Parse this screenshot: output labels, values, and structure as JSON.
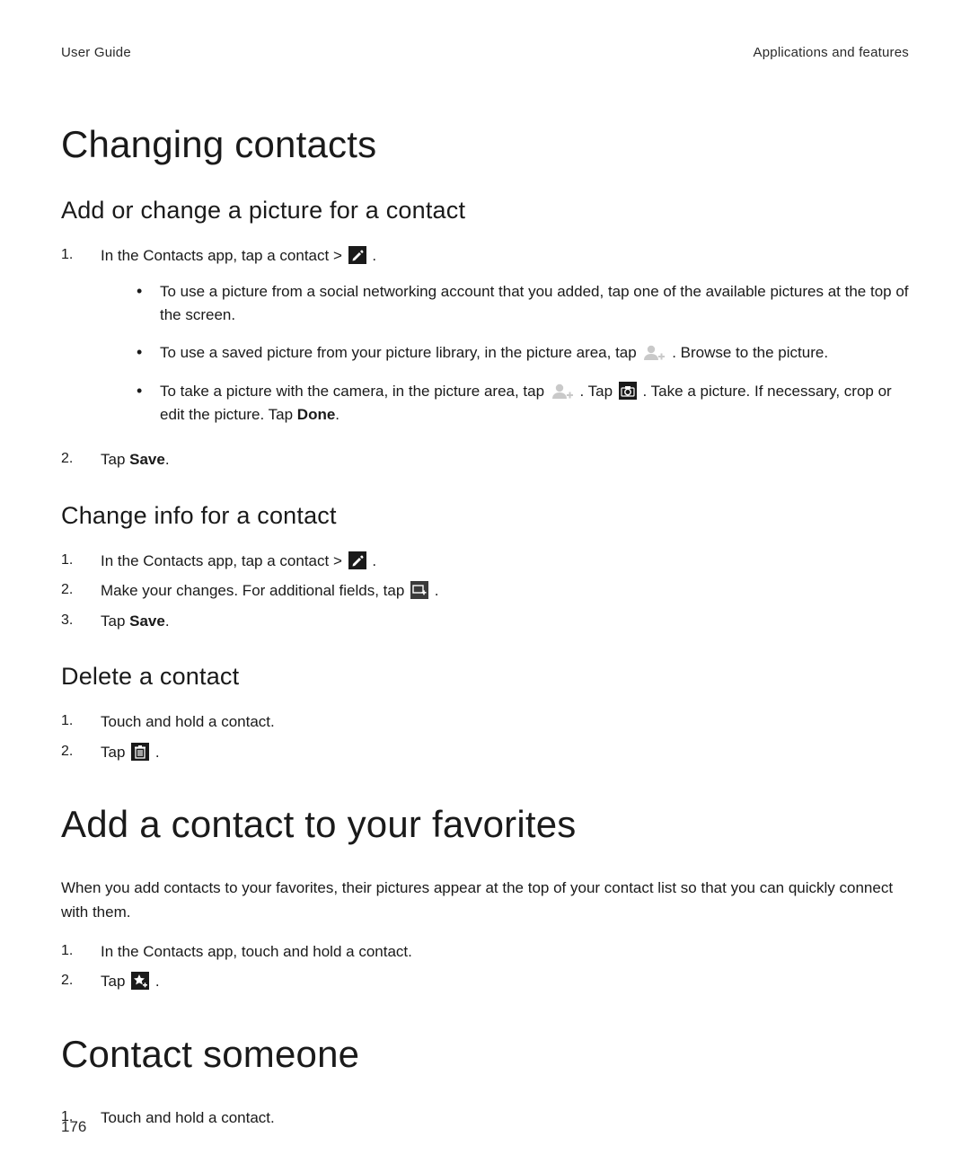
{
  "header": {
    "left": "User Guide",
    "right": "Applications and features"
  },
  "page_number": "176",
  "sections": {
    "changing_contacts": {
      "title": "Changing contacts",
      "add_picture": {
        "heading": "Add or change a picture for a contact",
        "step1_a": "In the Contacts app, tap a contact > ",
        "step1_b": " .",
        "bullet1": "To use a picture from a social networking account that you added, tap one of the available pictures at the top of the screen.",
        "bullet2_a": "To use a saved picture from your picture library, in the picture area, tap ",
        "bullet2_b": " . Browse to the picture.",
        "bullet3_a": "To take a picture with the camera, in the picture area, tap ",
        "bullet3_b": " . Tap ",
        "bullet3_c": " . Take a picture. If necessary, crop or edit the picture. Tap ",
        "bullet3_done": "Done",
        "bullet3_d": ".",
        "step2_a": "Tap ",
        "step2_save": "Save",
        "step2_b": "."
      },
      "change_info": {
        "heading": "Change info for a contact",
        "step1_a": "In the Contacts app, tap a contact > ",
        "step1_b": " .",
        "step2_a": "Make your changes. For additional fields, tap ",
        "step2_b": " .",
        "step3_a": "Tap ",
        "step3_save": "Save",
        "step3_b": "."
      },
      "delete_contact": {
        "heading": "Delete a contact",
        "step1": "Touch and hold a contact.",
        "step2_a": "Tap ",
        "step2_b": " ."
      }
    },
    "favorites": {
      "title": "Add a contact to your favorites",
      "intro": "When you add contacts to your favorites, their pictures appear at the top of your contact list so that you can quickly connect with them.",
      "step1": "In the Contacts app, touch and hold a contact.",
      "step2_a": "Tap ",
      "step2_b": " ."
    },
    "contact_someone": {
      "title": "Contact someone",
      "step1": "Touch and hold a contact."
    }
  }
}
